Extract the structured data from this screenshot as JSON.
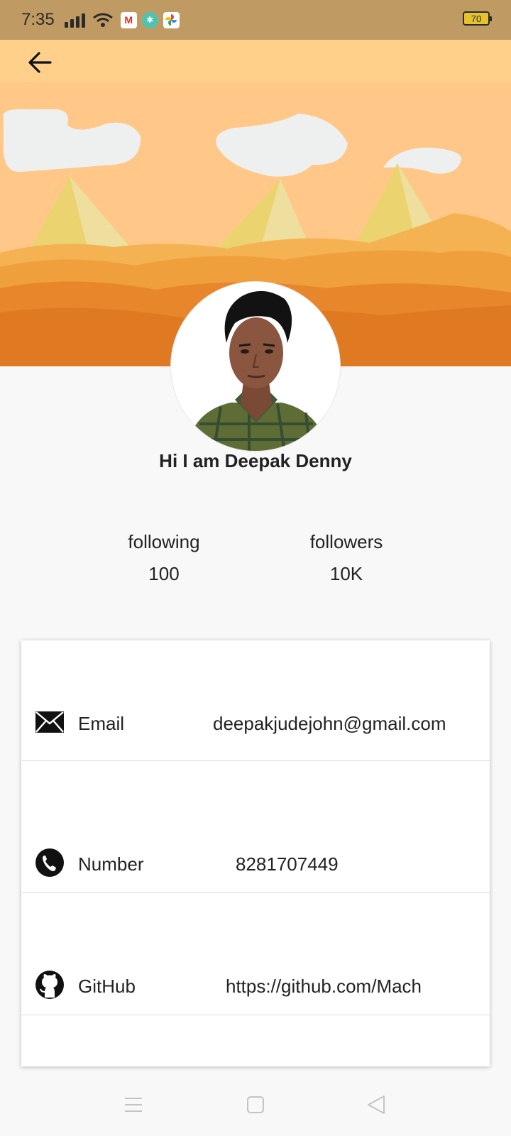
{
  "status_bar": {
    "time": "7:35",
    "battery": "70",
    "notifications": [
      "gmail-icon",
      "app-icon",
      "photos-icon"
    ]
  },
  "app_bar": {
    "back_icon": "arrow-left-icon"
  },
  "profile": {
    "name": "Hi I am Deepak Denny",
    "following_label": "following",
    "following_value": "100",
    "followers_label": "followers",
    "followers_value": "10K"
  },
  "contact": {
    "rows": [
      {
        "icon": "envelope-icon",
        "label": "Email",
        "value": "deepakjudejohn@gmail.com"
      },
      {
        "icon": "phone-icon",
        "label": "Number",
        "value": "8281707449"
      },
      {
        "icon": "github-icon",
        "label": "GitHub",
        "value": "https://github.com/Mach"
      }
    ]
  },
  "colors": {
    "status_bar": "#bf9a62",
    "sky": "#ffd08a",
    "sand_dark": "#e07a22",
    "background": "#f8f8f8"
  }
}
